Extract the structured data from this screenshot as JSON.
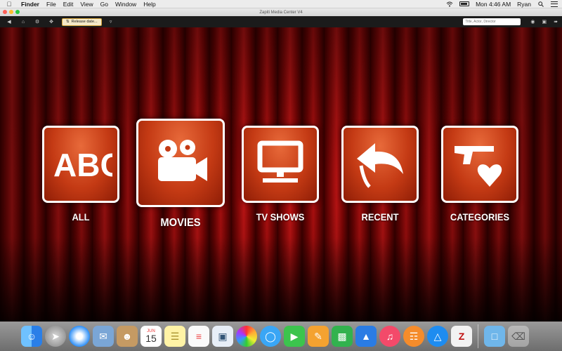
{
  "menubar": {
    "app_name": "Finder",
    "menus": [
      "File",
      "Edit",
      "View",
      "Go",
      "Window",
      "Help"
    ],
    "clock": "Mon 4:46 AM",
    "user": "Ryan"
  },
  "window": {
    "title": "Zapiti Media Center V4"
  },
  "toolbar": {
    "sort_label": "Release date...",
    "search_placeholder": "Title, Actor, Director"
  },
  "tiles": [
    {
      "label": "ALL",
      "icon": "abc-icon"
    },
    {
      "label": "MOVIES",
      "icon": "movie-camera-icon"
    },
    {
      "label": "TV SHOWS",
      "icon": "tv-icon"
    },
    {
      "label": "RECENT",
      "icon": "back-arrow-icon"
    },
    {
      "label": "CATEGORIES",
      "icon": "gun-heart-icon"
    }
  ],
  "tile_abc_text": "ABC",
  "dock": {
    "calendar_month": "JUN",
    "calendar_day": "15",
    "apps": [
      "finder",
      "launchpad",
      "safari",
      "mail",
      "contacts",
      "calendar",
      "notes",
      "reminders",
      "preview",
      "photos",
      "messages",
      "facetime",
      "pages",
      "numbers",
      "keynote",
      "itunes",
      "ibooks",
      "app-store",
      "zapiti",
      "downloads-folder",
      "trash"
    ]
  },
  "colors": {
    "tile_base": "#c43a14",
    "curtain": "#a80f0f",
    "sort_chip": "#f4e9c8"
  }
}
